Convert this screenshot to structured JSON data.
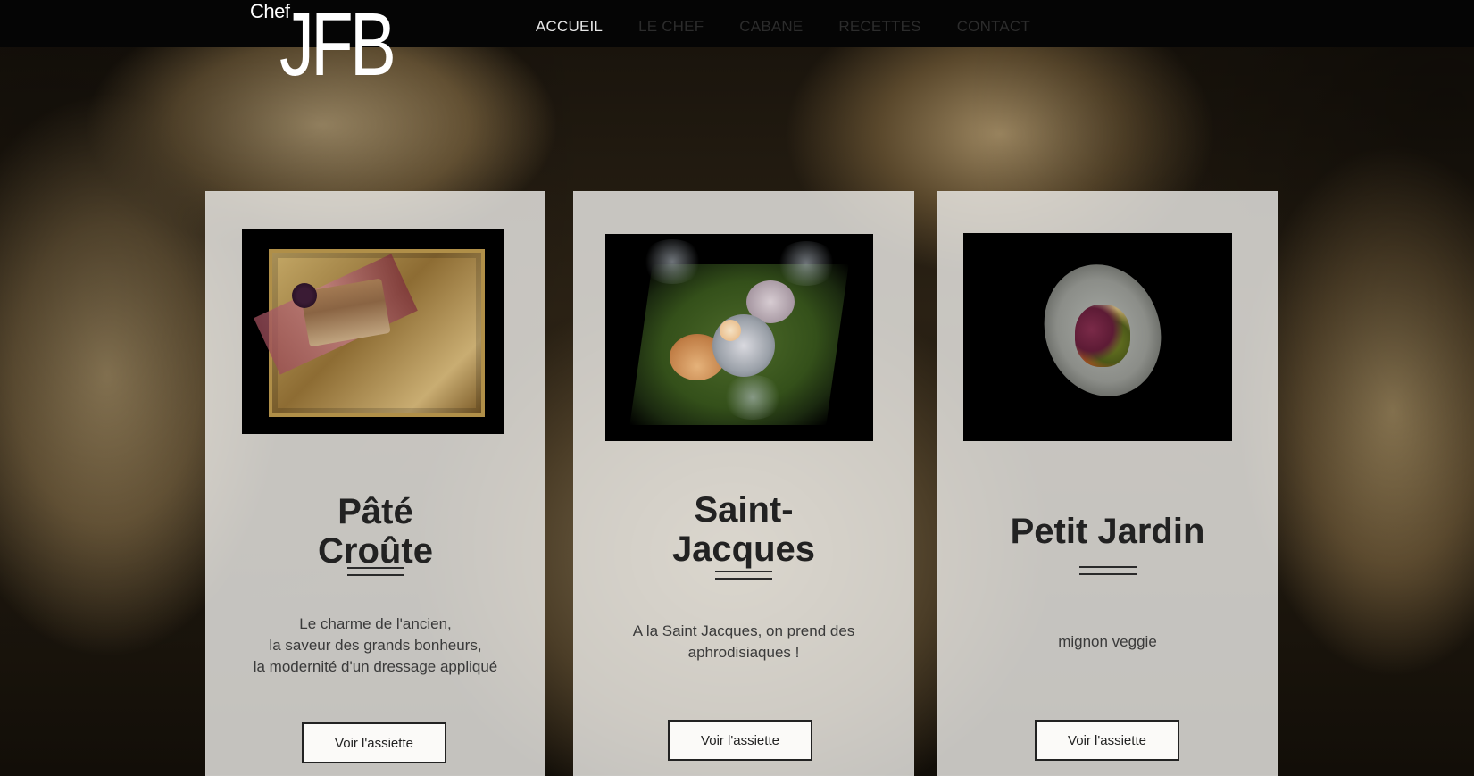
{
  "logo": {
    "chef": "Chef",
    "jfb": "JFB"
  },
  "nav": [
    {
      "label": "ACCUEIL",
      "active": true
    },
    {
      "label": "LE CHEF",
      "active": false
    },
    {
      "label": "CABANE",
      "active": false
    },
    {
      "label": "RECETTES",
      "active": false
    },
    {
      "label": "CONTACT",
      "active": false
    }
  ],
  "cards": [
    {
      "title": "Pâté\nCroûte",
      "description": "Le charme de l'ancien,\nla saveur des grands bonheurs,\nla modernité d'un dressage appliqué",
      "button": "Voir l'assiette"
    },
    {
      "title": "Saint-\nJacques",
      "description": "A la Saint Jacques, on prend des\naphrodisiaques !",
      "button": "Voir l'assiette"
    },
    {
      "title": "Petit Jardin",
      "description": "mignon veggie",
      "button": "Voir l'assiette"
    }
  ]
}
